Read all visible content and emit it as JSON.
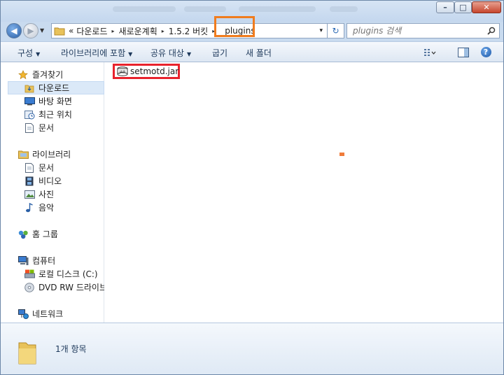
{
  "window": {
    "caption_buttons": [
      {
        "name": "minimize-button",
        "glyph": "–"
      },
      {
        "name": "maximize-button",
        "glyph": "□"
      },
      {
        "name": "close-button",
        "glyph": "✕"
      }
    ]
  },
  "address": {
    "overflow": "«",
    "crumbs": [
      "다운로드",
      "새로운계획",
      "1.5.2 버킷",
      "plugins"
    ],
    "separator": "▸",
    "dropdown": "▾",
    "refresh": "↻"
  },
  "search": {
    "placeholder": "plugins 검색"
  },
  "toolbar": {
    "organize": "구성",
    "include_in_library": "라이브러리에 포함",
    "share_with": "공유 대상",
    "burn": "굽기",
    "new_folder": "새 폴더",
    "help": "?"
  },
  "nav": {
    "favorites": {
      "label": "즐겨찾기",
      "items": [
        "다운로드",
        "바탕 화면",
        "최근 위치",
        "문서"
      ]
    },
    "libraries": {
      "label": "라이브러리",
      "items": [
        "문서",
        "비디오",
        "사진",
        "음악"
      ]
    },
    "homegroup": "홈 그룹",
    "computer": {
      "label": "컴퓨터",
      "items": [
        "로컬 디스크 (C:)",
        "DVD RW 드라이브"
      ]
    },
    "network": "네트워크"
  },
  "files": [
    {
      "name": "setmotd.jar",
      "icon": "jar-file-icon"
    }
  ],
  "status": {
    "count": "1개 항목"
  },
  "colors": {
    "highlight_red": "#e8222d",
    "highlight_orange": "#f07c1e",
    "selection": "#dbe9f8"
  }
}
